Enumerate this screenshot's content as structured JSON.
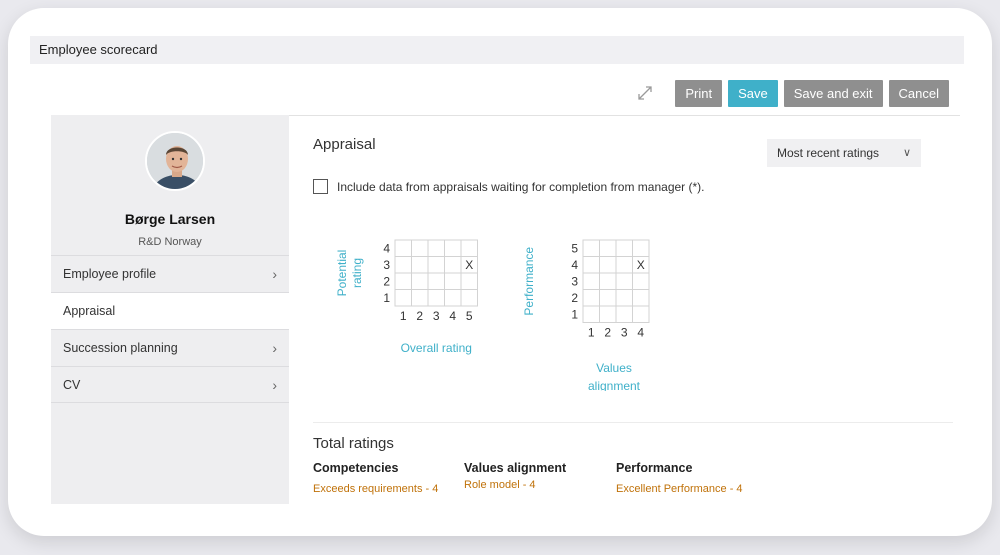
{
  "window": {
    "title": "Employee scorecard"
  },
  "toolbar": {
    "expand_icon": "expand-arrows-icon",
    "print_label": "Print",
    "save_label": "Save",
    "save_exit_label": "Save and exit",
    "cancel_label": "Cancel"
  },
  "employee": {
    "name": "Børge Larsen",
    "department": "R&D Norway"
  },
  "sidebar": {
    "items": [
      {
        "label": "Employee profile",
        "chevron": true
      },
      {
        "label": "Appraisal",
        "chevron": false,
        "active": true
      },
      {
        "label": "Succession planning",
        "chevron": true
      },
      {
        "label": "CV",
        "chevron": true
      }
    ]
  },
  "appraisal": {
    "title": "Appraisal",
    "dropdown_value": "Most recent ratings",
    "checkbox_label": "Include data from appraisals waiting for completion from manager (*).",
    "grid1": {
      "y_label_lines": [
        "Potential",
        "rating"
      ],
      "x_label": "Overall rating",
      "y_ticks": [
        "4",
        "3",
        "2",
        "1"
      ],
      "x_ticks": [
        "1",
        "2",
        "3",
        "4",
        "5"
      ],
      "mark": "X",
      "mark_x": 5,
      "mark_y": 3
    },
    "grid2": {
      "y_label": "Performance",
      "x_label_lines": [
        "Values",
        "alignment"
      ],
      "y_ticks": [
        "5",
        "4",
        "3",
        "2",
        "1"
      ],
      "x_ticks": [
        "1",
        "2",
        "3",
        "4"
      ],
      "mark": "X",
      "mark_x": 4,
      "mark_y": 4
    }
  },
  "totals": {
    "title": "Total ratings",
    "items": [
      {
        "label": "Competencies",
        "value": "Exceeds requirements - 4"
      },
      {
        "label": "Values alignment",
        "value": "Role model - 4"
      },
      {
        "label": "Performance",
        "value": "Excellent Performance - 4"
      }
    ]
  },
  "colors": {
    "accent": "#3fb0c9",
    "rating_value": "#c0720a",
    "button_grey": "#8f8f8f"
  }
}
